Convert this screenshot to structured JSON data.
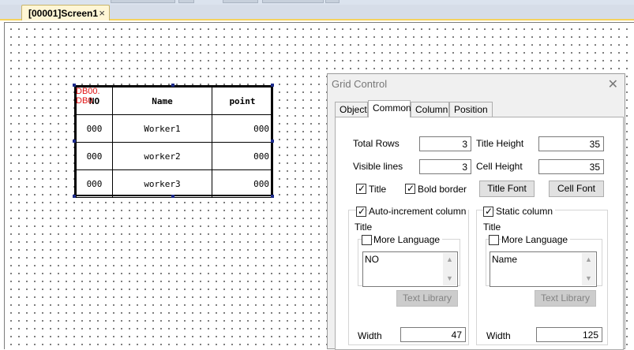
{
  "screen_tab": {
    "label": "[00001]Screen1",
    "close_glyph": "×"
  },
  "grid_widget": {
    "tags": [
      "DB00.",
      "DB0"
    ],
    "headers": [
      "NO",
      "Name",
      "point"
    ],
    "rows": [
      [
        "000",
        "Worker1",
        "000"
      ],
      [
        "000",
        "worker2",
        "000"
      ],
      [
        "000",
        "worker3",
        "000"
      ]
    ]
  },
  "dialog": {
    "title": "Grid Control",
    "close_glyph": "✕",
    "tabs": [
      "Object",
      "Common",
      "Column",
      "Position"
    ],
    "active_tab": "Common",
    "total_rows_label": "Total Rows",
    "total_rows": "3",
    "visible_lines_label": "Visible lines",
    "visible_lines": "3",
    "title_height_label": "Title Height",
    "title_height": "35",
    "cell_height_label": "Cell Height",
    "cell_height": "35",
    "title_checkbox": {
      "label": "Title",
      "checked": true
    },
    "bold_border_checkbox": {
      "label": "Bold border",
      "checked": true
    },
    "title_font_button": "Title Font",
    "cell_font_button": "Cell Font",
    "auto_increment": {
      "label": "Auto-increment column",
      "checked": true,
      "title_label": "Title",
      "more_language": "More Language",
      "text": "NO",
      "text_library_button": "Text Library",
      "width_label": "Width",
      "width": "47"
    },
    "static_column": {
      "label": "Static column",
      "checked": true,
      "title_label": "Title",
      "more_language": "More Language",
      "text": "Name",
      "text_library_button": "Text Library",
      "width_label": "Width",
      "width": "125"
    }
  },
  "colors": {
    "tag_red": "#e01010",
    "handle": "#1c2a8a",
    "tab_accent": "#f5d35c"
  },
  "icons": {
    "checkmark": "✓",
    "scroll_up": "▲",
    "scroll_down": "▼"
  }
}
